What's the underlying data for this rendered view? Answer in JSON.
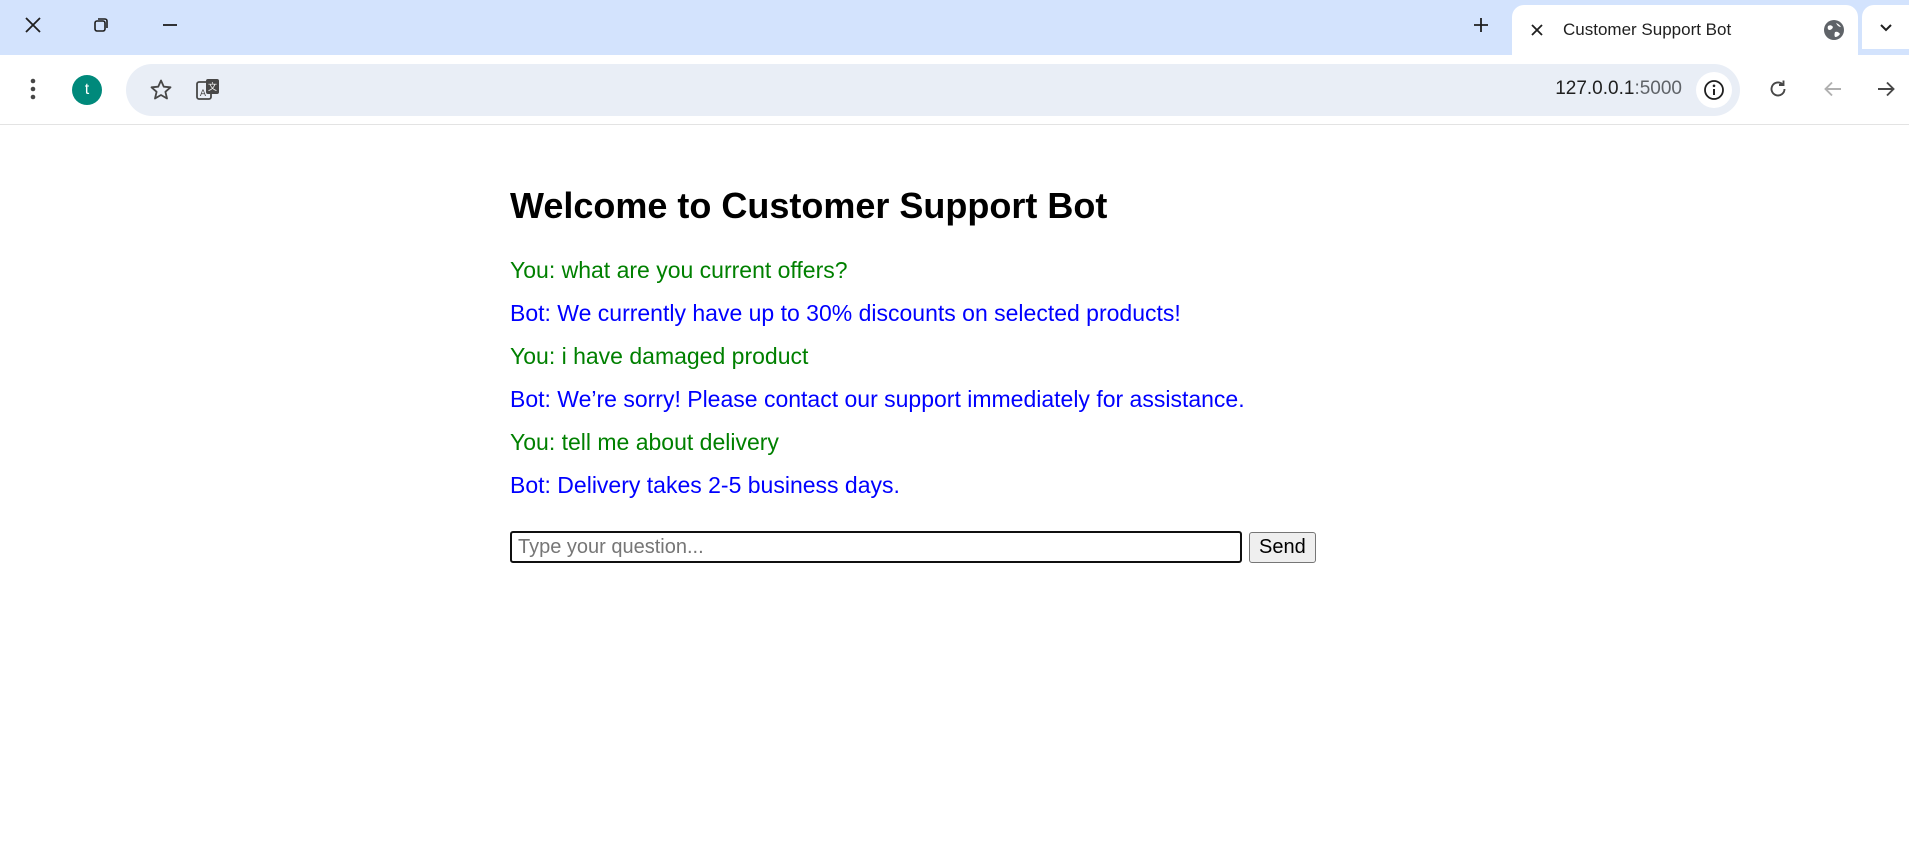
{
  "browser": {
    "tab": {
      "title": "Customer Support Bot"
    },
    "profile_initial": "t",
    "url": {
      "host": "127.0.0.1",
      "port": ":5000"
    }
  },
  "page": {
    "heading": "Welcome to Customer Support Bot",
    "messages": [
      {
        "role": "user",
        "text": "You: what are you current offers?"
      },
      {
        "role": "bot",
        "text": "Bot: We currently have up to 30% discounts on selected products!"
      },
      {
        "role": "user",
        "text": "You: i have damaged product"
      },
      {
        "role": "bot",
        "text": "Bot: We’re sorry! Please contact our support immediately for assistance."
      },
      {
        "role": "user",
        "text": "You: tell me about delivery"
      },
      {
        "role": "bot",
        "text": "Bot: Delivery takes 2-5 business days."
      }
    ],
    "input": {
      "placeholder": "Type your question...",
      "value": ""
    },
    "send_label": "Send"
  },
  "colors": {
    "user_message": "#008000",
    "bot_message": "#0000ff",
    "tabstrip": "#d3e3fd",
    "omnibox": "#e9eef6",
    "avatar": "#00897b"
  }
}
